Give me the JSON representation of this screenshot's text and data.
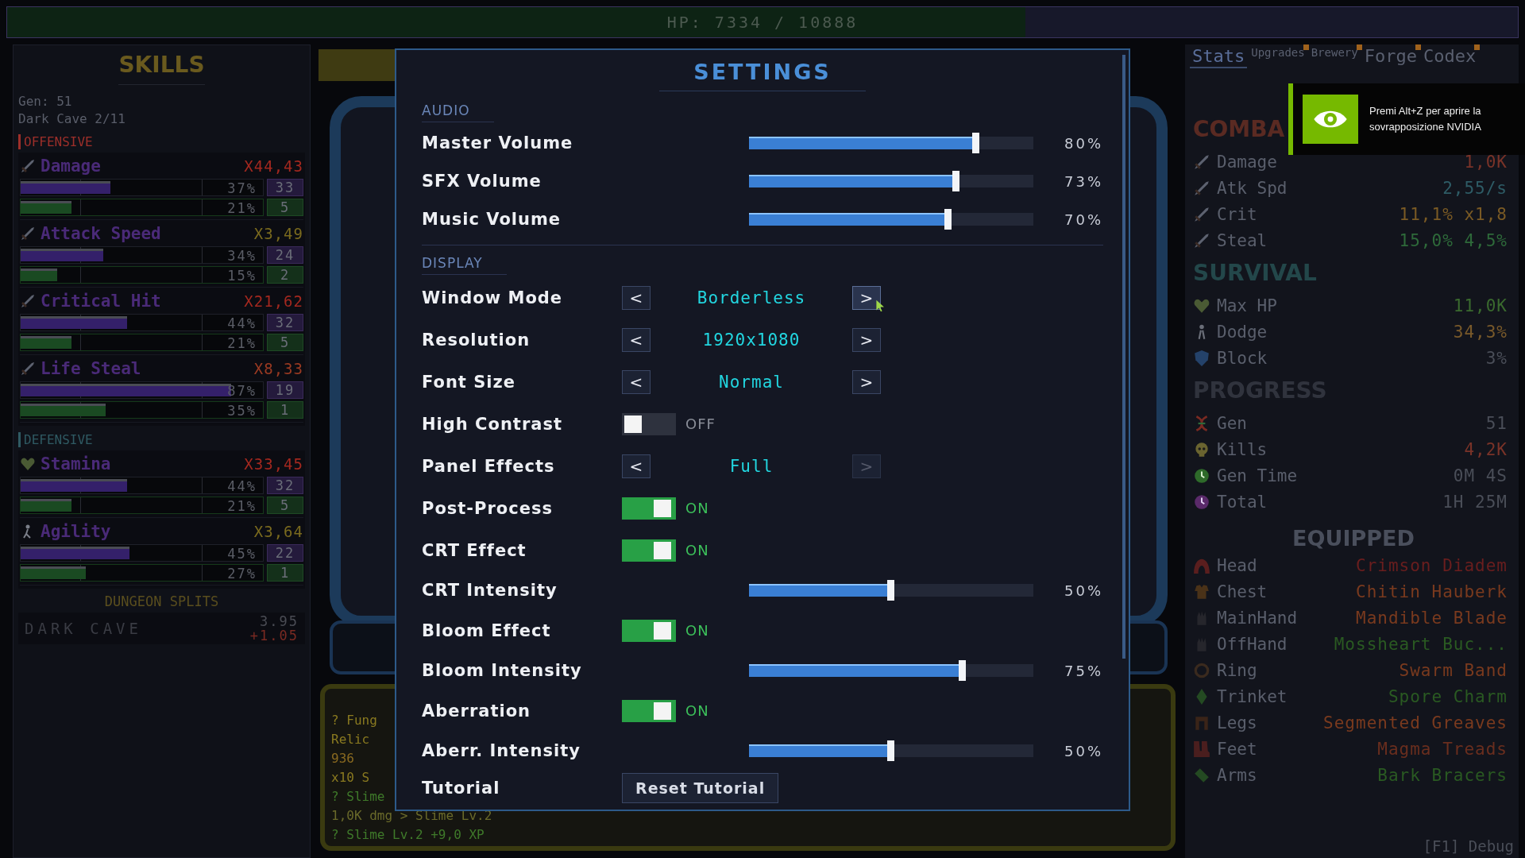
{
  "hp_bar": {
    "text": "HP: 7334 / 10888",
    "level": 0.674
  },
  "skills_panel": {
    "title": "SKILLS",
    "gen": "Gen: 51",
    "dungeon": "Dark Cave 2/11",
    "groups": [
      {
        "name": "OFFENSIVE",
        "color": "#9e2f2a",
        "skills": [
          {
            "name": "Damage",
            "multiplier": "X44,43",
            "color": "#a3281f",
            "bars": [
              {
                "kind": "xp",
                "level": 0.37,
                "reading": "37%",
                "count": "33"
              },
              {
                "kind": "rank",
                "level": 0.21,
                "reading": "21%",
                "count": "5"
              }
            ]
          },
          {
            "name": "Attack Speed",
            "multiplier": "X3,49",
            "color": "#7a6a1e",
            "bars": [
              {
                "kind": "xp",
                "level": 0.34,
                "reading": "34%",
                "count": "24"
              },
              {
                "kind": "rank",
                "level": 0.15,
                "reading": "15%",
                "count": "2"
              }
            ]
          },
          {
            "name": "Critical Hit",
            "multiplier": "X21,62",
            "color": "#a3281f",
            "bars": [
              {
                "kind": "xp",
                "level": 0.44,
                "reading": "44%",
                "count": "32"
              },
              {
                "kind": "rank",
                "level": 0.21,
                "reading": "21%",
                "count": "5"
              }
            ]
          },
          {
            "name": "Life Steal",
            "multiplier": "X8,33",
            "color": "#9a3a22",
            "bars": [
              {
                "kind": "xp",
                "level": 0.87,
                "reading": "87%",
                "count": "19"
              },
              {
                "kind": "rank",
                "level": 0.35,
                "reading": "35%",
                "count": "1"
              }
            ]
          }
        ]
      },
      {
        "name": "DEFENSIVE",
        "color": "#2f5a63",
        "skills": [
          {
            "name": "Stamina",
            "multiplier": "X33,45",
            "color": "#a3281f",
            "bars": [
              {
                "kind": "xp",
                "level": 0.44,
                "reading": "44%",
                "count": "32"
              },
              {
                "kind": "rank",
                "level": 0.21,
                "reading": "21%",
                "count": "5"
              }
            ]
          },
          {
            "name": "Agility",
            "multiplier": "X3,64",
            "color": "#7a6a1e",
            "bars": [
              {
                "kind": "xp",
                "level": 0.45,
                "reading": "45%",
                "count": "22"
              },
              {
                "kind": "rank",
                "level": 0.27,
                "reading": "27%",
                "count": "1"
              }
            ]
          }
        ]
      }
    ],
    "splits": {
      "title": "DUNGEON SPLITS",
      "rows": [
        {
          "name": "DARK CAVE",
          "time": "3.95",
          "delta": "+1.05"
        }
      ]
    }
  },
  "combat_log": {
    "lines": [
      {
        "text": "? Fung",
        "color": "#8a7a20"
      },
      {
        "text": "Relic",
        "color": "#8a7a20"
      },
      {
        "text": "936",
        "color": "#8a6a20"
      },
      {
        "text": "x10 S",
        "color": "#8a7a20"
      },
      {
        "text": "? Slime",
        "color": "#3f7a2a"
      },
      {
        "text": "1,0K dmg > Slime Lv.2",
        "color": "#6a6a2a"
      },
      {
        "text": "? Slime Lv.2 +9,0 XP",
        "color": "#3f7a2a"
      }
    ]
  },
  "settings": {
    "title": "SETTINGS",
    "sections": [
      {
        "title": "AUDIO",
        "rows": [
          {
            "kind": "slider",
            "label": "Master Volume",
            "level": 0.8,
            "reading": "80%"
          },
          {
            "kind": "slider",
            "label": "SFX Volume",
            "level": 0.73,
            "reading": "73%"
          },
          {
            "kind": "slider",
            "label": "Music Volume",
            "level": 0.7,
            "reading": "70%"
          }
        ]
      },
      {
        "title": "DISPLAY",
        "rows": [
          {
            "kind": "selector",
            "label": "Window Mode",
            "value": "Borderless",
            "prev": "<",
            "next": ">",
            "next_hovered": true,
            "next_disabled": false
          },
          {
            "kind": "selector",
            "label": "Resolution",
            "value": "1920x1080",
            "prev": "<",
            "next": ">",
            "next_hovered": false,
            "next_disabled": false
          },
          {
            "kind": "selector",
            "label": "Font Size",
            "value": "Normal",
            "prev": "<",
            "next": ">",
            "next_hovered": false,
            "next_disabled": false
          },
          {
            "kind": "toggle",
            "label": "High Contrast",
            "on": false,
            "state_label": "OFF"
          },
          {
            "kind": "selector",
            "label": "Panel Effects",
            "value": "Full",
            "prev": "<",
            "next": ">",
            "next_hovered": false,
            "next_disabled": true
          },
          {
            "kind": "toggle",
            "label": "Post-Process",
            "on": true,
            "state_label": "ON"
          },
          {
            "kind": "toggle",
            "label": "CRT Effect",
            "on": true,
            "state_label": "ON"
          },
          {
            "kind": "slider",
            "label": "CRT Intensity",
            "level": 0.5,
            "reading": "50%"
          },
          {
            "kind": "toggle",
            "label": "Bloom Effect",
            "on": true,
            "state_label": "ON"
          },
          {
            "kind": "slider",
            "label": "Bloom Intensity",
            "level": 0.75,
            "reading": "75%"
          },
          {
            "kind": "toggle",
            "label": "Aberration",
            "on": true,
            "state_label": "ON"
          },
          {
            "kind": "slider",
            "label": "Aberr. Intensity",
            "level": 0.5,
            "reading": "50%"
          },
          {
            "kind": "button",
            "label": "Tutorial",
            "button": "Reset Tutorial"
          }
        ]
      }
    ]
  },
  "side_panel": {
    "tabs": [
      {
        "label": "Stats",
        "selected": true,
        "badge": false
      },
      {
        "label": "Upgrades",
        "selected": false,
        "badge": true
      },
      {
        "label": "Brewery",
        "selected": false,
        "badge": true
      },
      {
        "label": "Forge",
        "selected": false,
        "badge": true
      },
      {
        "label": "Codex",
        "selected": false,
        "badge": true
      }
    ],
    "sections": [
      {
        "title": "COMBA",
        "color": "#5a2a22",
        "rows": [
          {
            "label": "Damage",
            "value": "1,0K",
            "color": "#7a3328"
          },
          {
            "label": "Atk Spd",
            "value": "2,55/s",
            "color": "#2e5c66"
          },
          {
            "label": "Crit",
            "value": "11,1% x1,8",
            "color": "#7a5a24"
          },
          {
            "label": "Steal",
            "value": "15,0% 4,5%",
            "color": "#2e6a3a"
          }
        ]
      },
      {
        "title": "SURVIVAL",
        "color": "#23474a",
        "rows": [
          {
            "label": "Max HP",
            "value": "11,0K",
            "color": "#3a6a2e"
          },
          {
            "label": "Dodge",
            "value": "34,3%",
            "color": "#7a5a2a"
          },
          {
            "label": "Block",
            "value": "3%",
            "color": "#4a4e58"
          }
        ]
      },
      {
        "title": "PROGRESS",
        "color": "#30333d",
        "rows": [
          {
            "label": "Gen",
            "value": "51",
            "color": "#4a4e58"
          },
          {
            "label": "Kills",
            "value": "4,2K",
            "color": "#7a3328"
          },
          {
            "label": "Gen Time",
            "value": "0M 4S",
            "color": "#4a4e58"
          },
          {
            "label": "Total",
            "value": "1H 25M",
            "color": "#4a4e58"
          }
        ]
      },
      {
        "title": "EQUIPPED",
        "color": "#4a4f5c",
        "rows": [
          {
            "label": "Head",
            "value": "Crimson Diadem",
            "color": "#6a1e1e"
          },
          {
            "label": "Chest",
            "value": "Chitin Hauberk",
            "color": "#7a3a1e"
          },
          {
            "label": "MainHand",
            "value": "Mandible Blade",
            "color": "#7a3a1e"
          },
          {
            "label": "OffHand",
            "value": "Mossheart Buc...",
            "color": "#2a5a22"
          },
          {
            "label": "Ring",
            "value": "Swarm Band",
            "color": "#7a3a1e"
          },
          {
            "label": "Trinket",
            "value": "Spore Charm",
            "color": "#2a5a22"
          },
          {
            "label": "Legs",
            "value": "Segmented Greaves",
            "color": "#7a3a1e"
          },
          {
            "label": "Feet",
            "value": "Magma Treads",
            "color": "#6a2e1e"
          },
          {
            "label": "Arms",
            "value": "Bark Bracers",
            "color": "#2a5a22"
          }
        ]
      }
    ],
    "debug_hint": "[F1] Debug"
  },
  "overlay": {
    "text": "Premi Alt+Z per aprire la sovrapposizione NVIDIA"
  }
}
